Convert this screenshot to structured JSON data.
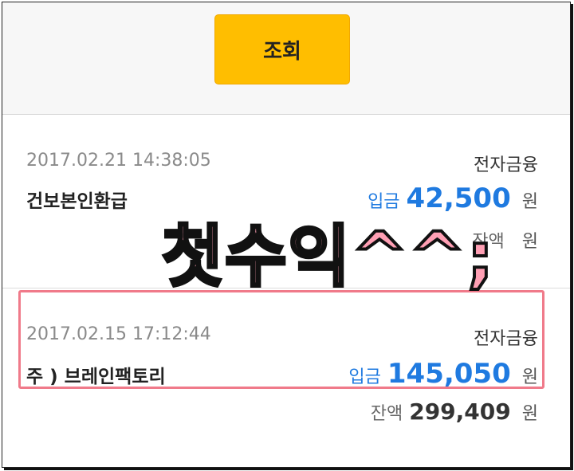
{
  "query_button": {
    "label": "조회"
  },
  "transactions": [
    {
      "datetime": "2017.02.21 14:38:05",
      "category": "전자금융",
      "name": "건보본인환급",
      "deposit_label": "입금",
      "deposit_amount": "42,500",
      "currency": "원",
      "balance_label": "잔액",
      "balance_amount": "",
      "balance_currency": "원"
    },
    {
      "datetime": "2017.02.15 17:12:44",
      "category": "전자금융",
      "name": "주 ) 브레인팩토리",
      "deposit_label": "입금",
      "deposit_amount": "145,050",
      "currency": "원",
      "balance_label": "잔액",
      "balance_amount": "299,409",
      "balance_currency": "원"
    }
  ],
  "overlay_caption": "첫수익^^;",
  "colors": {
    "button": "#ffbe00",
    "deposit": "#1f7ae0",
    "highlight": "#f07a8a",
    "overlay_fill": "#ff9fb4"
  }
}
